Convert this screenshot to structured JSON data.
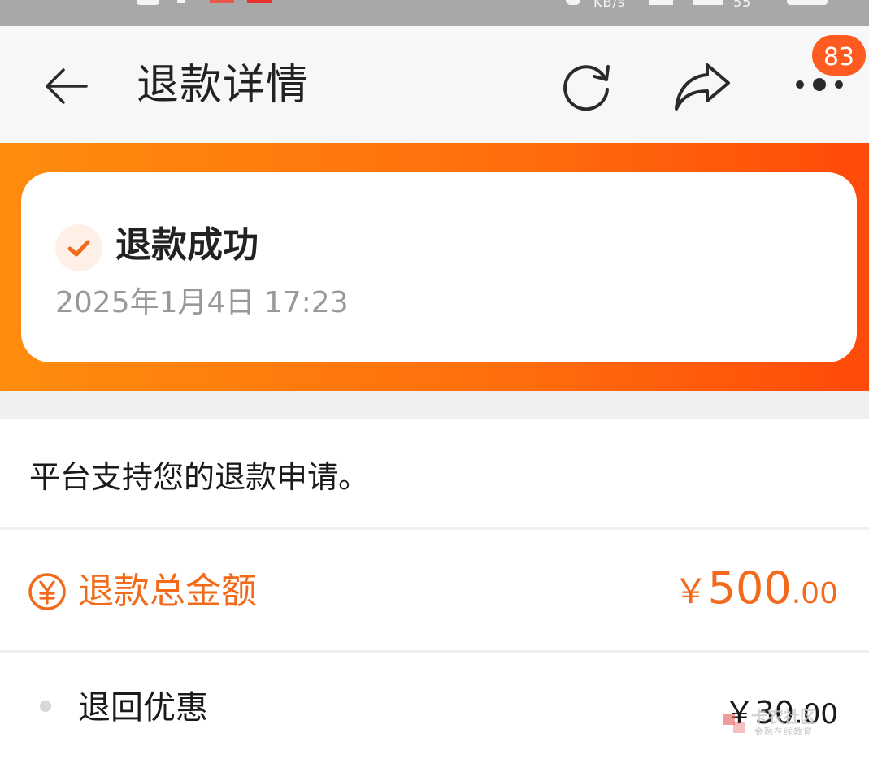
{
  "status_bar": {
    "speed": "KB/s",
    "battery": "55"
  },
  "nav": {
    "title": "退款详情",
    "badge_count": "83",
    "icons": [
      "back-arrow-icon",
      "refresh-icon",
      "share-icon",
      "more-icon"
    ]
  },
  "status_card": {
    "title": "退款成功",
    "time": "2025年1月4日 17:23"
  },
  "notice": "平台支持您的退款申请。",
  "total": {
    "label": "退款总金额",
    "currency": "￥",
    "amount_int": "500",
    "amount_dec": ".00"
  },
  "items": [
    {
      "label": "退回优惠",
      "currency": "￥",
      "amount_int": "30",
      "amount_dec": ".00"
    }
  ],
  "watermark": {
    "name": "卡农社区",
    "subtitle": "金融在线教育"
  },
  "colors": {
    "accent": "#f26a1b",
    "badge": "#ff5a1f",
    "hero_start": "#ff8c0e",
    "hero_end": "#ff4a09"
  }
}
